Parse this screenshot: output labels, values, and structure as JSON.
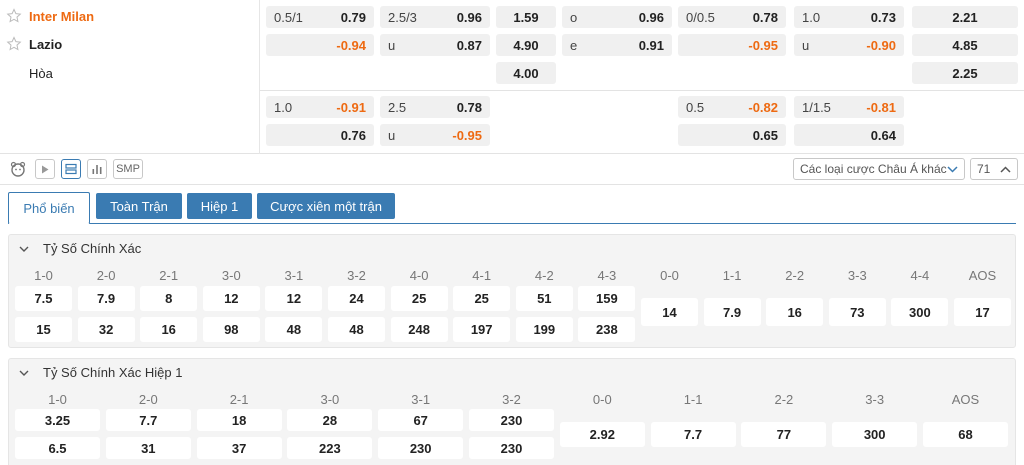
{
  "teams": {
    "home": "Inter Milan",
    "away": "Lazio",
    "draw": "Hòa"
  },
  "odds_main": [
    {
      "line_label": "0.5/1",
      "home": "0.79",
      "away": "-0.94"
    },
    {
      "line_label": "2.5/3",
      "over_label": "",
      "over": "0.96",
      "under_label": "u",
      "under": "0.87"
    },
    {
      "home": "1.59",
      "away": "4.90",
      "draw": "4.00"
    },
    {
      "over_label": "o",
      "over": "0.96",
      "under_label": "e",
      "under": "0.91"
    },
    {
      "line_label": "0/0.5",
      "home": "0.78",
      "away": "-0.95"
    },
    {
      "line_label": "1.0",
      "over": "0.73",
      "under_label": "u",
      "under": "-0.90"
    },
    {
      "home": "2.21",
      "away": "4.85",
      "draw": "2.25"
    }
  ],
  "odds_alt": [
    {
      "line_label": "1.0",
      "home": "-0.91",
      "away": "0.76"
    },
    {
      "line_label": "2.5",
      "over": "0.78",
      "under_label": "u",
      "under": "-0.95"
    },
    {
      "line_label": "0.5",
      "home": "-0.82",
      "away": "0.65"
    },
    {
      "line_label": "1/1.5",
      "over": "-0.81",
      "under": "0.64"
    }
  ],
  "toolbar": {
    "smp_label": "SMP",
    "market_select": "Các loại cược Châu Á khác",
    "count_select": "71"
  },
  "tabs": [
    "Phổ biến",
    "Toàn Trận",
    "Hiệp 1",
    "Cược xiên một trận"
  ],
  "correct_score": {
    "title": "Tỷ Số Chính Xác",
    "home_scores": [
      "1-0",
      "2-0",
      "2-1",
      "3-0",
      "3-1",
      "3-2",
      "4-0",
      "4-1",
      "4-2",
      "4-3"
    ],
    "home_win_odds": [
      "7.5",
      "7.9",
      "8",
      "12",
      "12",
      "24",
      "25",
      "25",
      "51",
      "159"
    ],
    "away_win_odds": [
      "15",
      "32",
      "16",
      "98",
      "48",
      "48",
      "248",
      "197",
      "199",
      "238"
    ],
    "draw_scores": [
      "0-0",
      "1-1",
      "2-2",
      "3-3",
      "4-4",
      "AOS"
    ],
    "draw_odds": [
      "14",
      "7.9",
      "16",
      "73",
      "300",
      "17"
    ]
  },
  "correct_score_h1": {
    "title": "Tỷ Số Chính Xác Hiệp 1",
    "home_scores": [
      "1-0",
      "2-0",
      "2-1",
      "3-0",
      "3-1",
      "3-2"
    ],
    "home_win_odds": [
      "3.25",
      "7.7",
      "18",
      "28",
      "67",
      "230"
    ],
    "away_win_odds": [
      "6.5",
      "31",
      "37",
      "223",
      "230",
      "230"
    ],
    "draw_scores": [
      "0-0",
      "1-1",
      "2-2",
      "3-3",
      "AOS"
    ],
    "draw_odds": [
      "2.92",
      "7.7",
      "77",
      "300",
      "68"
    ]
  },
  "colors": {
    "accent_blue": "#3a7bb2",
    "negative_orange": "#ee6a12"
  }
}
